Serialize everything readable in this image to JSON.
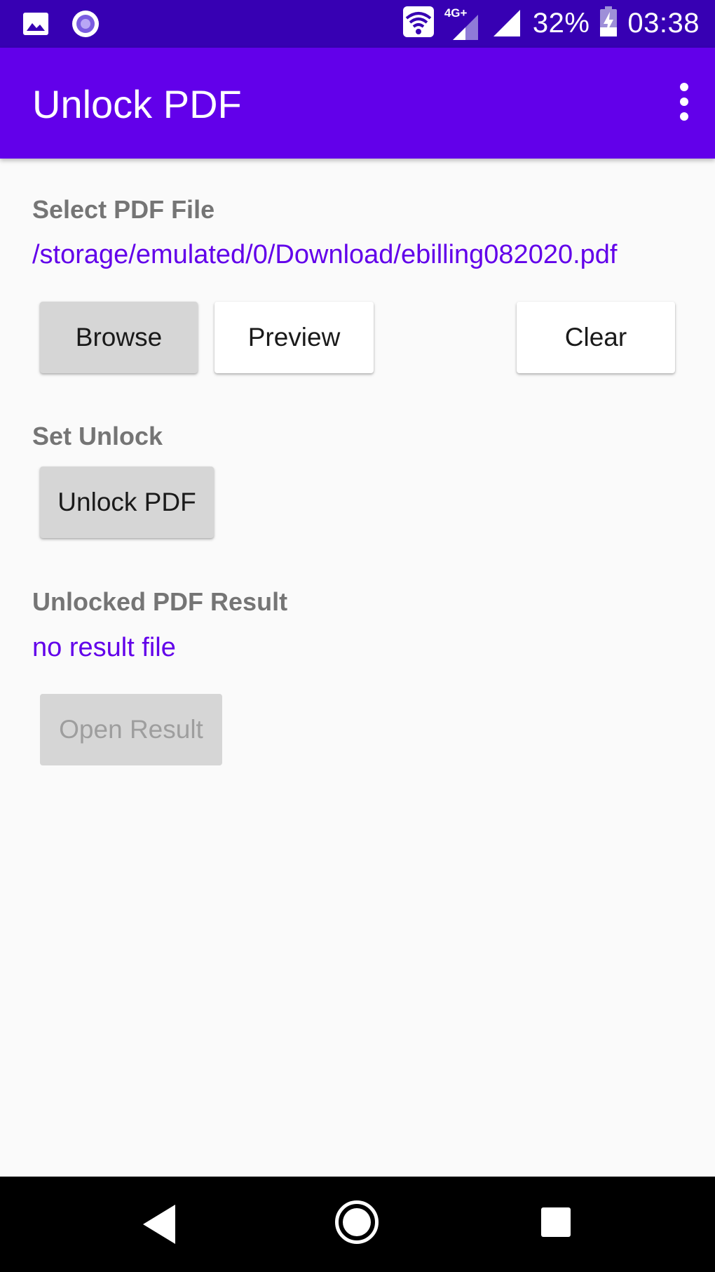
{
  "status_bar": {
    "network_label": "4G+",
    "battery": "32%",
    "time": "03:38",
    "icons": [
      "image-icon",
      "record-icon",
      "wifi-icon",
      "signal-icon",
      "signal-icon",
      "battery-charging-icon"
    ]
  },
  "app_bar": {
    "title": "Unlock PDF",
    "menu_icon": "overflow-menu-icon"
  },
  "select_file": {
    "label": "Select PDF File",
    "path": "/storage/emulated/0/Download/ebilling082020.pdf",
    "browse_label": "Browse",
    "preview_label": "Preview",
    "clear_label": "Clear"
  },
  "set_unlock": {
    "label": "Set Unlock",
    "unlock_label": "Unlock PDF"
  },
  "result": {
    "label": "Unlocked PDF Result",
    "value": "no result file",
    "open_label": "Open Result"
  },
  "nav_bar": {
    "icons": [
      "back-icon",
      "home-icon",
      "recents-icon"
    ]
  },
  "colors": {
    "status_bar": "#3700b3",
    "app_bar": "#6200ea",
    "accent_text": "#6200ea",
    "label_text": "#757575",
    "background": "#fafafa"
  }
}
